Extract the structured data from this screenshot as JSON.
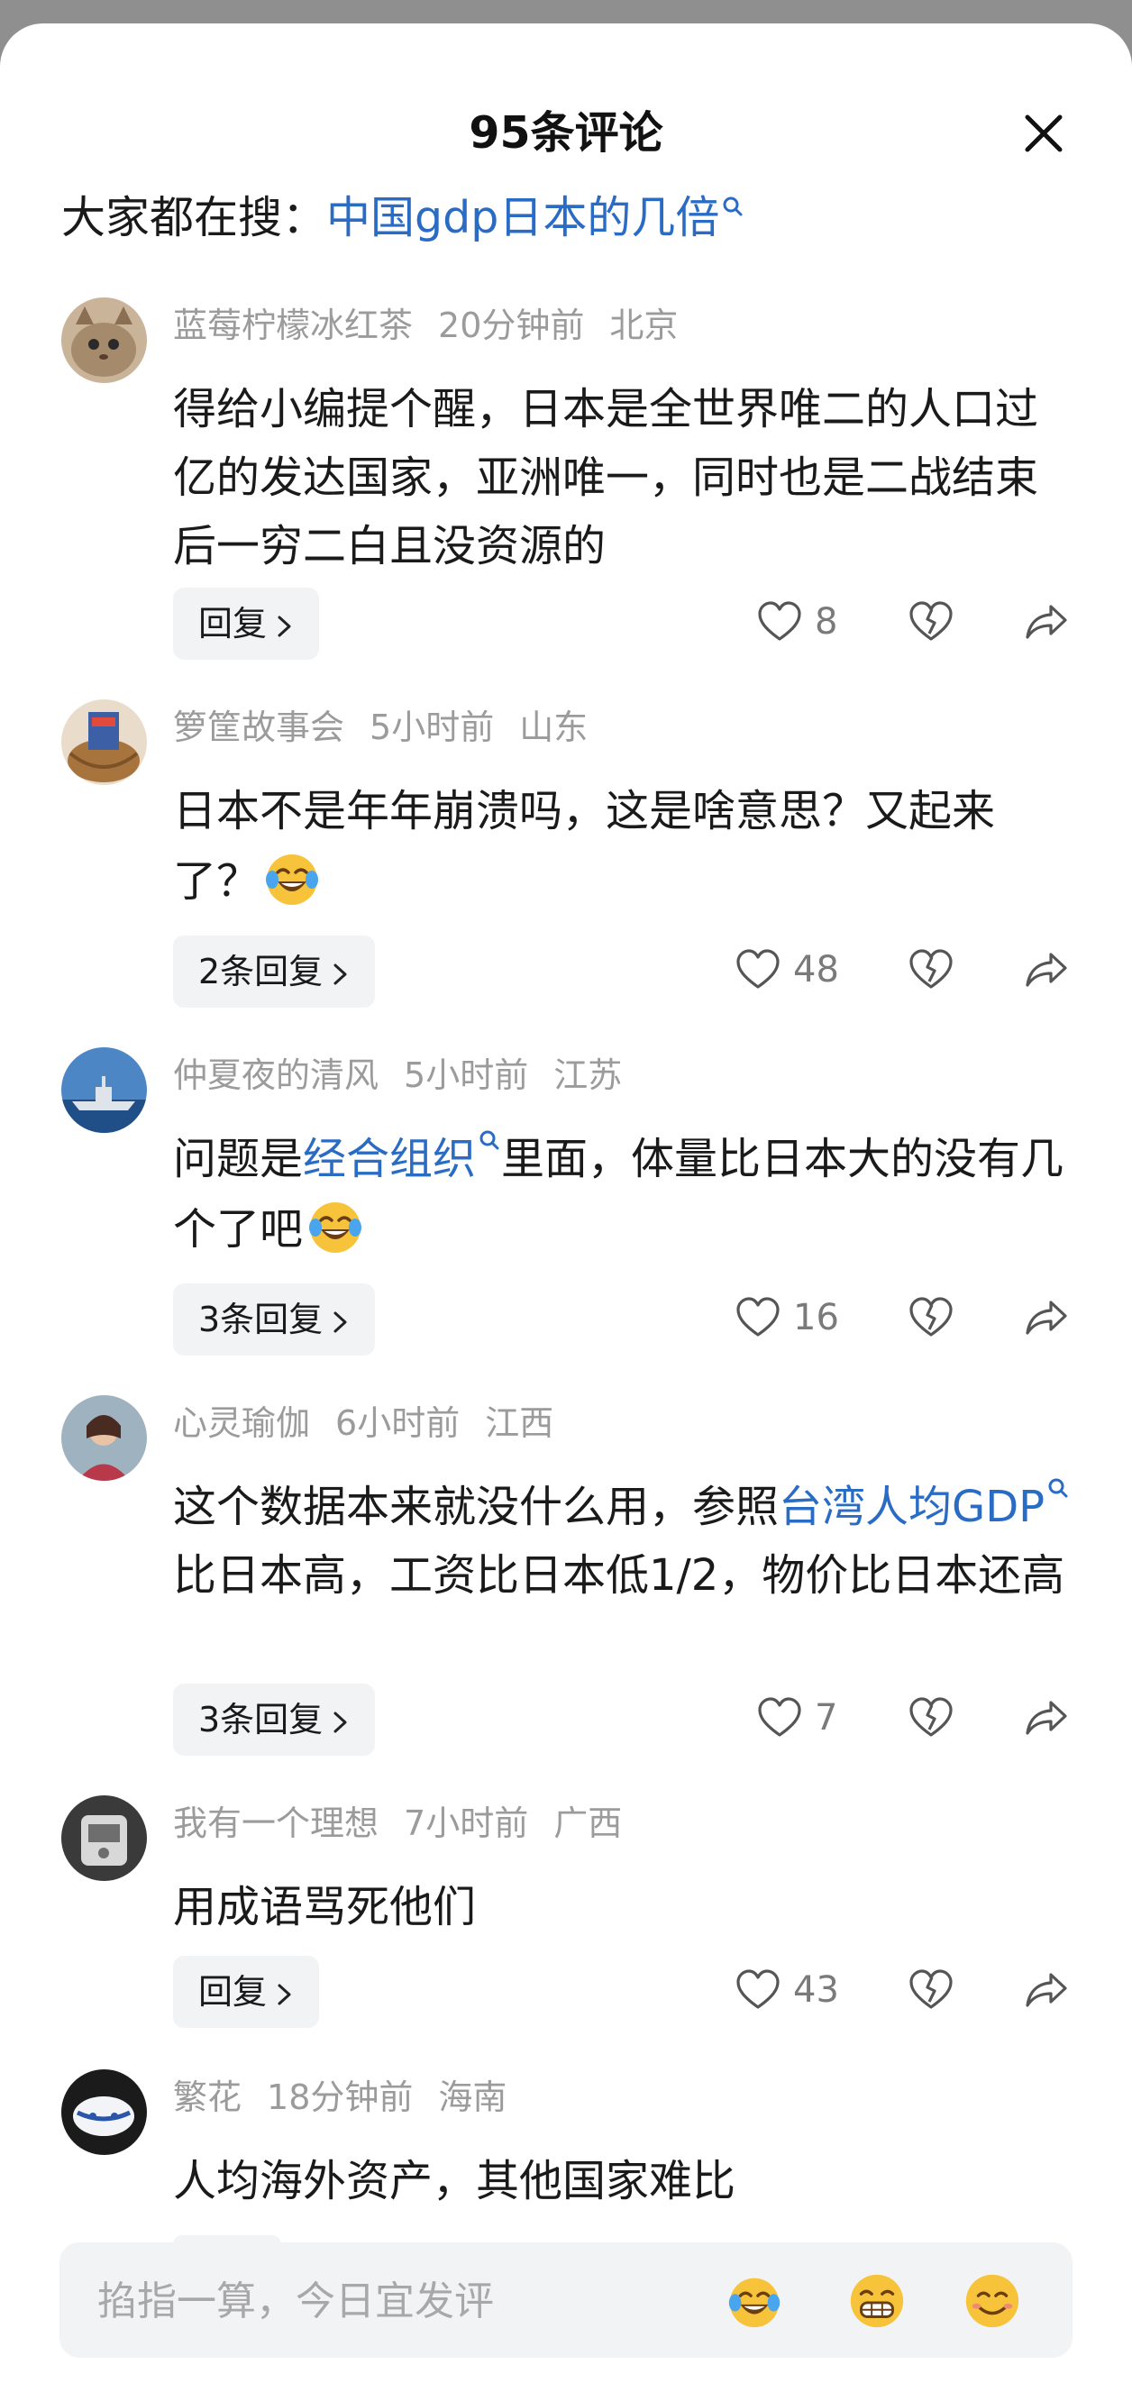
{
  "header": {
    "title": "95条评论"
  },
  "hot_search": {
    "prefix": "大家都在搜：",
    "query": "中国gdp日本的几倍"
  },
  "comments": [
    {
      "user": "蓝莓柠檬冰红茶",
      "time": "20分钟前",
      "location": "北京",
      "text_parts": [
        "得给小编提个醒，日本是全世界唯二的人口过亿的发达国家，亚洲唯一，同时也是二战结束后一穷二白且没资源的"
      ],
      "reply_label": "回复",
      "likes": "8"
    },
    {
      "user": "箩筐故事会",
      "time": "5小时前",
      "location": "山东",
      "text_parts": [
        "日本不是年年崩溃吗，这是啥意思？又起来了？"
      ],
      "reply_label": "2条回复",
      "likes": "48"
    },
    {
      "user": "仲夏夜的清风",
      "time": "5小时前",
      "location": "江苏",
      "text_parts": [
        "问题是",
        "经合组织",
        "里面，体量比日本大的没有几个了吧"
      ],
      "reply_label": "3条回复",
      "likes": "16"
    },
    {
      "user": "心灵瑜伽",
      "time": "6小时前",
      "location": "江西",
      "text_parts": [
        "这个数据本来就没什么用，参照",
        "台湾人均GDP",
        "比日本高，工资比日本低1/2，物价比日本还高"
      ],
      "reply_label": "3条回复",
      "likes": "7"
    },
    {
      "user": "我有一个理想",
      "time": "7小时前",
      "location": "广西",
      "text_parts": [
        "用成语骂死他们"
      ],
      "reply_label": "回复",
      "likes": "43"
    },
    {
      "user": "繁花",
      "time": "18分钟前",
      "location": "海南",
      "text_parts": [
        "人均海外资产，其他国家难比"
      ]
    }
  ],
  "input": {
    "placeholder": "掐指一算，今日宜发评"
  },
  "colors": {
    "link": "#2a6cc4",
    "meta": "#9b9b9b",
    "chip_bg": "#f2f3f5",
    "emoji_face": "#f7c33a"
  },
  "icons": [
    "close-icon",
    "search-icon",
    "heart-icon",
    "broken-heart-icon",
    "share-icon",
    "chevron-right-icon",
    "laugh-cry-emoji",
    "grin-emoji",
    "smile-emoji"
  ]
}
